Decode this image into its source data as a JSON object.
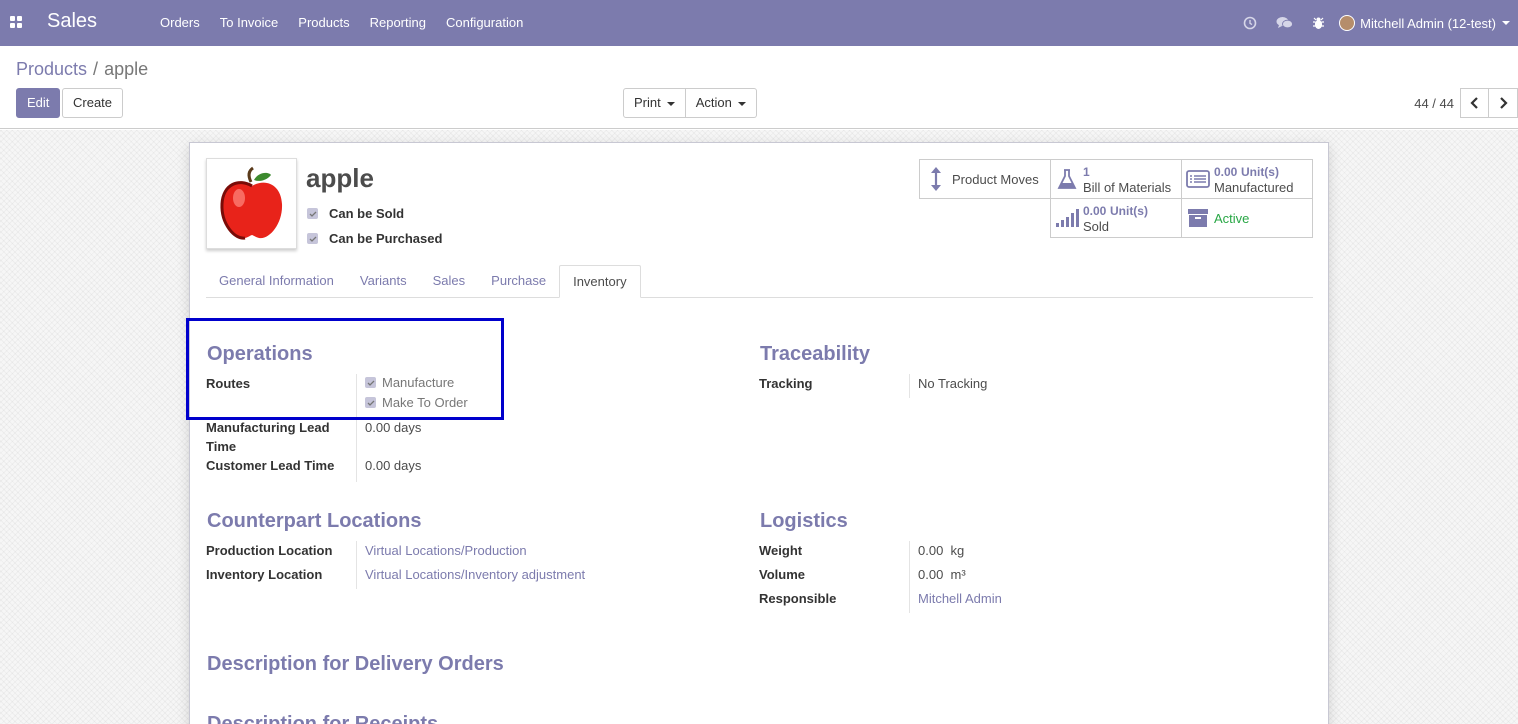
{
  "navbar": {
    "brand": "Sales",
    "menu": [
      "Orders",
      "To Invoice",
      "Products",
      "Reporting",
      "Configuration"
    ],
    "user": "Mitchell Admin (12-test)",
    "icons": [
      "clock-icon",
      "chat-icon",
      "bug-icon"
    ],
    "color": "#7c7bad"
  },
  "breadcrumb": {
    "parent": "Products",
    "separator": "/",
    "current": "apple"
  },
  "buttons": {
    "edit": "Edit",
    "create": "Create",
    "print": "Print",
    "action": "Action"
  },
  "pager": {
    "value": "44 / 44"
  },
  "product": {
    "name": "apple",
    "can_be_sold": "Can be Sold",
    "can_be_purchased": "Can be Purchased"
  },
  "smart_buttons": {
    "product_moves": "Product Moves",
    "bom_count": "1",
    "bom_label": "Bill of Materials",
    "manufactured_value": "0.00",
    "manufactured_uom": "Unit(s)",
    "manufactured_label": "Manufactured",
    "sold_value": "0.00",
    "sold_uom": "Unit(s)",
    "sold_label": "Sold",
    "active_label": "Active",
    "active_color": "#28a745"
  },
  "tabs": [
    "General Information",
    "Variants",
    "Sales",
    "Purchase",
    "Inventory"
  ],
  "operations": {
    "title": "Operations",
    "routes_label": "Routes",
    "routes": [
      "Manufacture",
      "Make To Order"
    ],
    "mfg_lead_label_1": "Manufacturing Lead",
    "mfg_lead_label_2": "Time",
    "mfg_lead_value": "0.00 days",
    "customer_lead_label": "Customer Lead Time",
    "customer_lead_value": "0.00 days"
  },
  "traceability": {
    "title": "Traceability",
    "tracking_label": "Tracking",
    "tracking_value": "No Tracking"
  },
  "counterpart": {
    "title": "Counterpart Locations",
    "production_label": "Production Location",
    "production_value": "Virtual Locations/Production",
    "inventory_label": "Inventory Location",
    "inventory_value": "Virtual Locations/Inventory adjustment"
  },
  "logistics": {
    "title": "Logistics",
    "weight_label": "Weight",
    "weight_value": "0.00",
    "weight_unit": "kg",
    "volume_label": "Volume",
    "volume_value": "0.00",
    "volume_unit": "m³",
    "responsible_label": "Responsible",
    "responsible_value": "Mitchell Admin"
  },
  "descriptions": {
    "delivery": "Description for Delivery Orders",
    "receipts": "Description for Receipts"
  }
}
